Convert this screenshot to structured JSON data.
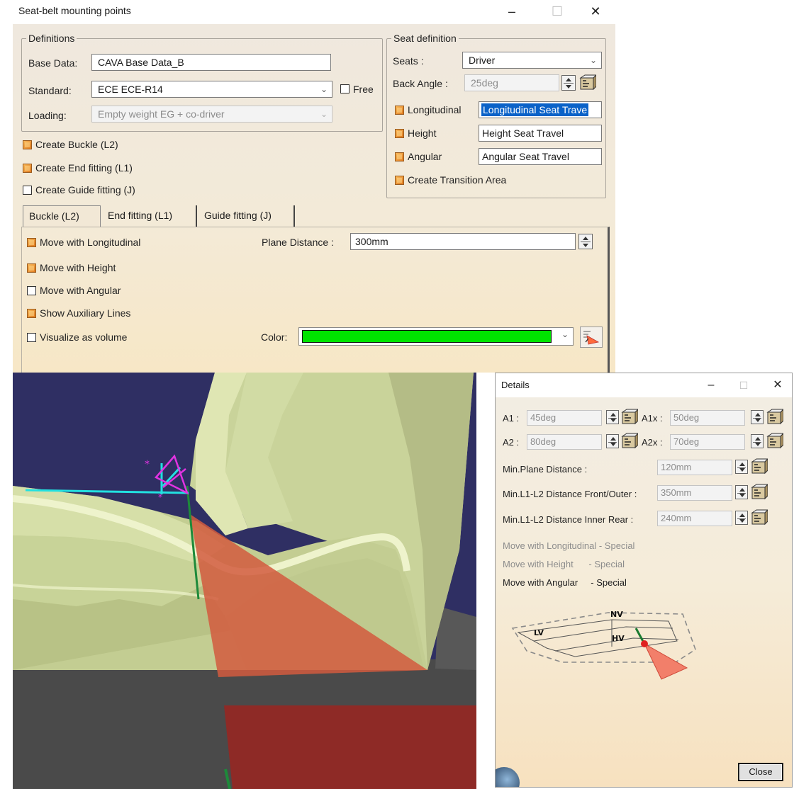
{
  "main_window": {
    "title": "Seat-belt mounting points",
    "minimize": "–",
    "maximize": "☐",
    "close": "✕"
  },
  "definitions": {
    "legend": "Definitions",
    "base_data_label": "Base Data:",
    "base_data_value": "CAVA Base Data_B",
    "standard_label": "Standard:",
    "standard_value": "ECE ECE-R14",
    "free_label": "Free",
    "free_checked": false,
    "loading_label": "Loading:",
    "loading_value": "Empty weight EG + co-driver"
  },
  "seat_definition": {
    "legend": "Seat definition",
    "seats_label": "Seats :",
    "seats_value": "Driver",
    "back_angle_label": "Back Angle :",
    "back_angle_value": "25deg",
    "longitudinal_label": "Longitudinal",
    "longitudinal_value": "Longitudinal Seat Trave",
    "height_label": "Height",
    "height_value": "Height Seat Travel",
    "angular_label": "Angular",
    "angular_value": "Angular Seat Travel",
    "transition_label": "Create Transition Area"
  },
  "options": {
    "create_buckle": "Create Buckle (L2)",
    "create_end_fitting": "Create End fitting (L1)",
    "create_guide_fitting": "Create Guide fitting (J)"
  },
  "tabs": [
    {
      "label": "Buckle (L2)",
      "active": true
    },
    {
      "label": "End fitting (L1)",
      "active": false
    },
    {
      "label": "Guide fitting (J)",
      "active": false
    }
  ],
  "buckle_panel": {
    "move_longitudinal": "Move with Longitudinal",
    "move_height": "Move with Height",
    "move_angular": "Move with Angular",
    "show_aux_lines": "Show Auxiliary Lines",
    "visualize_volume": "Visualize as volume",
    "plane_distance_label": "Plane Distance :",
    "plane_distance_value": "300mm",
    "color_label": "Color:",
    "color_value": "#00e400"
  },
  "details": {
    "title": "Details",
    "minimize": "–",
    "maximize": "☐",
    "close": "✕",
    "a1_label": "A1 :",
    "a1_value": "45deg",
    "a1x_label": "A1x :",
    "a1x_value": "50deg",
    "a2_label": "A2 :",
    "a2_value": "80deg",
    "a2x_label": "A2x :",
    "a2x_value": "70deg",
    "min_plane_label": "Min.Plane Distance :",
    "min_plane_value": "120mm",
    "min_front_label": "Min.L1-L2 Distance Front/Outer :",
    "min_front_value": "350mm",
    "min_rear_label": "Min.L1-L2 Distance Inner Rear :",
    "min_rear_value": "240mm",
    "move_long_special": "Move with Longitudinal - Special",
    "move_height_special": "Move with Height      - Special",
    "move_angular_special": "Move with Angular     - Special",
    "diagram_lv": "LV",
    "diagram_nv": "NV",
    "diagram_hv": "HV",
    "close_button": "Close"
  },
  "colors": {
    "checkbox_on": "#e07a1e",
    "selection": "#0a62c8",
    "viewport_bg": "#2f2f63"
  }
}
